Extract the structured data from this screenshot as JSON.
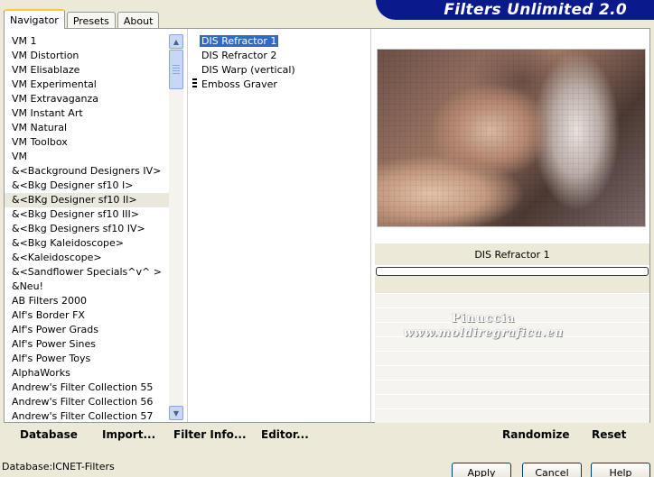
{
  "tabs": [
    {
      "label": "Navigator",
      "active": true
    },
    {
      "label": "Presets",
      "active": false
    },
    {
      "label": "About",
      "active": false
    }
  ],
  "app_title": "Filters Unlimited 2.0",
  "categories": [
    "VM 1",
    "VM Distortion",
    "VM Elisablaze",
    "VM Experimental",
    "VM Extravaganza",
    "VM Instant Art",
    "VM Natural",
    "VM Toolbox",
    "VM",
    "&<Background Designers IV>",
    "&<Bkg Designer sf10 I>",
    "&<BKg Designer sf10 II>",
    "&<Bkg Designer sf10 III>",
    "&<Bkg Designers sf10 IV>",
    "&<Bkg Kaleidoscope>",
    "&<Kaleidoscope>",
    "&<Sandflower Specials^v^ >",
    "&Neu!",
    "AB Filters 2000",
    "Alf's Border FX",
    "Alf's Power Grads",
    "Alf's Power Sines",
    "Alf's Power Toys",
    "AlphaWorks",
    "Andrew's Filter Collection 55",
    "Andrew's Filter Collection 56",
    "Andrew's Filter Collection 57"
  ],
  "selected_category": "&<BKg Designer sf10 II>",
  "filters": [
    "DIS Refractor 1",
    "DIS Refractor 2",
    "DIS Warp (vertical)",
    "Emboss Graver"
  ],
  "selected_filter": "DIS Refractor 1",
  "params_title": "DIS Refractor 1",
  "watermark": {
    "line1": "Pinuccia",
    "line2": "www.moldiregrafica.eu"
  },
  "actions": {
    "database": "Database",
    "import": "Import...",
    "filter_info": "Filter Info...",
    "editor": "Editor...",
    "randomize": "Randomize",
    "reset": "Reset"
  },
  "status": {
    "database_label": "Database:",
    "database_value": "ICNET-Filters"
  },
  "buttons": {
    "apply": "Apply",
    "cancel": "Cancel",
    "help": "Help"
  }
}
